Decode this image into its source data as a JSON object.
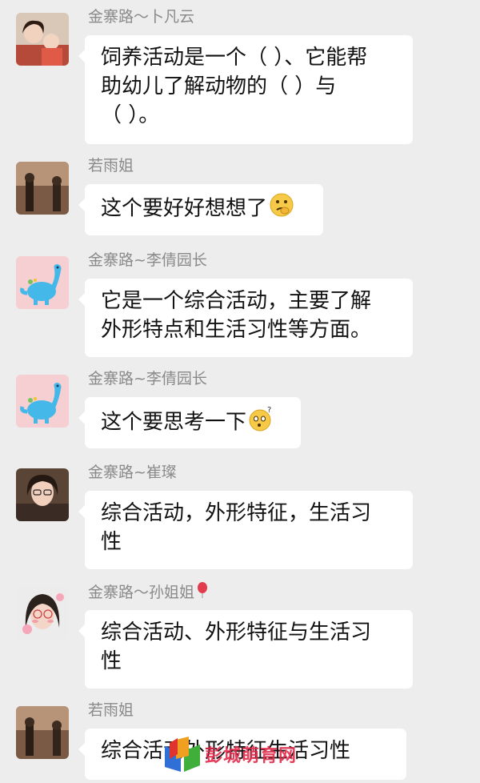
{
  "messages": [
    {
      "sender": "金寨路～卜凡云",
      "lines": [
        "饲养活动是一个（ ）、它能帮",
        "助幼儿了解动物的（ ）与",
        "（ ）。"
      ],
      "emoji": ""
    },
    {
      "sender": "若雨姐",
      "lines": [
        "这个要好好想想了"
      ],
      "emoji": "thinking-face-emoji"
    },
    {
      "sender": "金寨路~李倩园长",
      "lines": [
        "它是一个综合活动，主要了解",
        "外形特点和生活习性等方面。"
      ],
      "emoji": ""
    },
    {
      "sender": "金寨路~李倩园长",
      "lines": [
        "这个要思考一下"
      ],
      "emoji": "confused-face-emoji"
    },
    {
      "sender": "金寨路~崔璨",
      "lines": [
        "综合活动，外形特征，生活习",
        "性"
      ],
      "emoji": ""
    },
    {
      "sender": "金寨路～孙姐姐",
      "lines": [
        "综合活动、外形特征与生活习",
        "性"
      ],
      "emoji": "balloon-emoji"
    },
    {
      "sender": "若雨姐",
      "lines": [
        "综合活动外形特征生活习性"
      ],
      "emoji": ""
    }
  ],
  "watermark": {
    "text": "彭城萌育网"
  }
}
